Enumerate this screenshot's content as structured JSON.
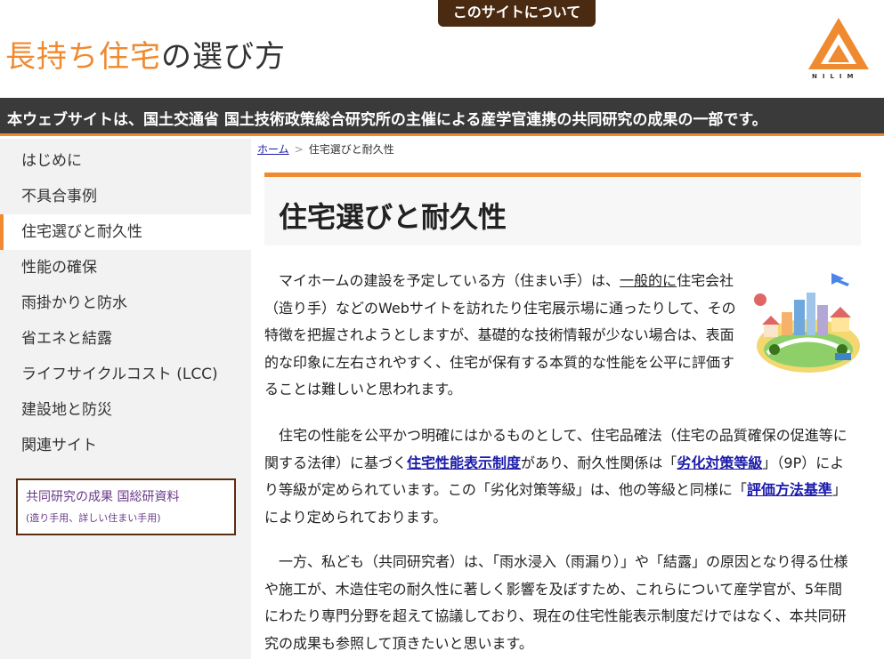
{
  "header": {
    "about_tab": "このサイトについて",
    "title_accent": "長持ち住宅",
    "title_rest": "の選び方",
    "logo_text": "NILIM"
  },
  "banner": {
    "text": "本ウェブサイトは、国土交通省 国土技術政策総合研究所の主催による産学官連携の共同研究の成果の一部です。"
  },
  "sidebar": {
    "items": [
      {
        "label": "はじめに",
        "active": false
      },
      {
        "label": "不具合事例",
        "active": false
      },
      {
        "label": "住宅選びと耐久性",
        "active": true
      },
      {
        "label": "性能の確保",
        "active": false
      },
      {
        "label": "雨掛かりと防水",
        "active": false
      },
      {
        "label": "省エネと結露",
        "active": false
      },
      {
        "label": "ライフサイクルコスト (LCC)",
        "active": false
      },
      {
        "label": "建設地と防災",
        "active": false
      },
      {
        "label": "関連サイト",
        "active": false
      }
    ],
    "research_box": {
      "title": "共同研究の成果 国総研資料",
      "subtitle": "(造り手用、詳しい住まい手用)"
    }
  },
  "breadcrumb": {
    "home": "ホーム",
    "separator": ">",
    "current": "住宅選びと耐久性"
  },
  "main": {
    "title": "住宅選びと耐久性",
    "p1": {
      "a": "　マイホームの建設を予定している方（住まい手）は、",
      "link": "一般的に",
      "b": "住宅会社（造り手）などのWebサイトを訪れたり住宅展示場に通ったりして、その特徴を把握されようとしますが、基礎的な技術情報が少ない場合は、表面的な印象に左右されやすく、住宅が保有する本質的な性能を公平に評価することは難しいと思われます。"
    },
    "p2": {
      "a": "　住宅の性能を公平かつ明確にはかるものとして、住宅品確法（住宅の品質確保の促進等に関する法律）に基づく",
      "link1": "住宅性能表示制度",
      "b": "があり、耐久性関係は「",
      "link2": "劣化対策等級",
      "c": "」（9P）により等級が定められています。この「劣化対策等級」は、他の等級と同様に「",
      "link3": "評価方法基準",
      "d": "」により定められております。"
    },
    "p3": {
      "text": "　一方、私ども（共同研究者）は、「雨水浸入（雨漏り）」や「結露」の原因となり得る仕様や施工が、木造住宅の耐久性に著しく影響を及ぼすため、これらについて産学官が、5年間にわたり専門分野を超えて協議しており、現在の住宅性能表示制度だけではなく、本共同研究の成果も参照して頂きたいと思います。"
    }
  },
  "colors": {
    "accent": "#f08a30",
    "banner_bg": "#3a3a3a",
    "tab_bg": "#4a2a10",
    "link": "#1a1aaa",
    "sidebar_bg": "#f2f2f2"
  }
}
